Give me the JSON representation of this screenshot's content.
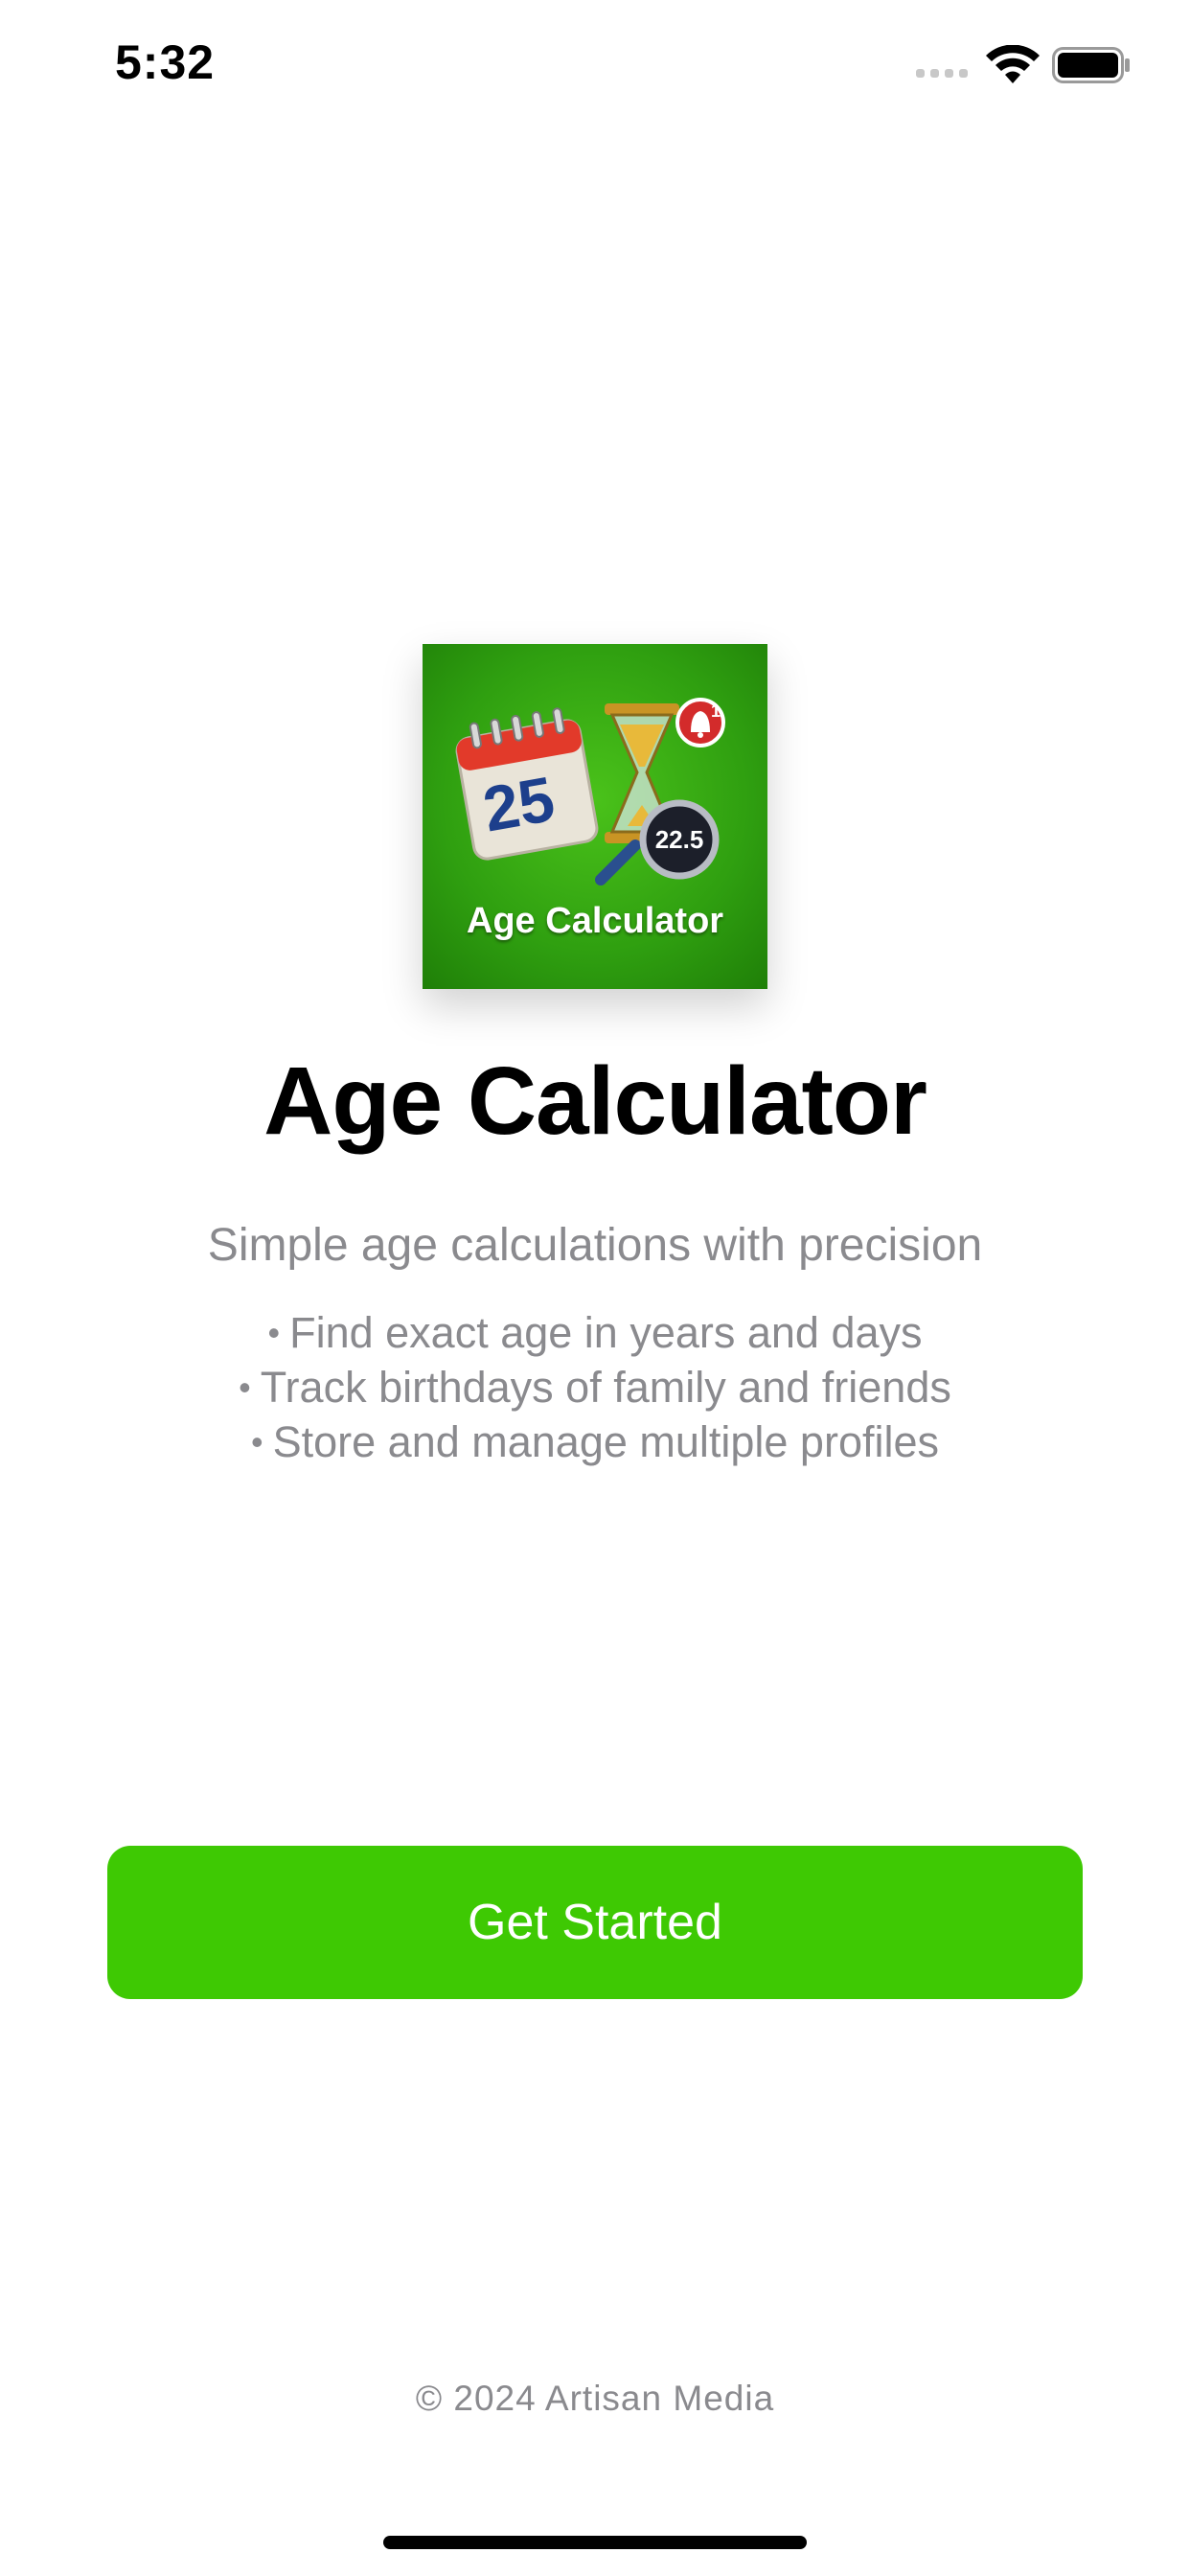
{
  "status_bar": {
    "time": "5:32"
  },
  "app_icon": {
    "calendar_day": "25",
    "gauge_value": "22.5",
    "badge_count": "1",
    "title": "Age Calculator"
  },
  "main": {
    "title": "Age Calculator",
    "tagline": "Simple age calculations with precision",
    "features": [
      "Find exact age in years and days",
      "Track birthdays of family and friends",
      "Store and manage multiple profiles"
    ]
  },
  "cta": {
    "label": "Get Started"
  },
  "footer": {
    "copyright": "© 2024 Artisan Media"
  },
  "colors": {
    "accent": "#3ec903",
    "muted_text": "#8a8a8e"
  },
  "icons": [
    "wifi-icon",
    "battery-icon",
    "calendar-icon",
    "hourglass-icon",
    "bell-icon",
    "magnifier-icon"
  ]
}
